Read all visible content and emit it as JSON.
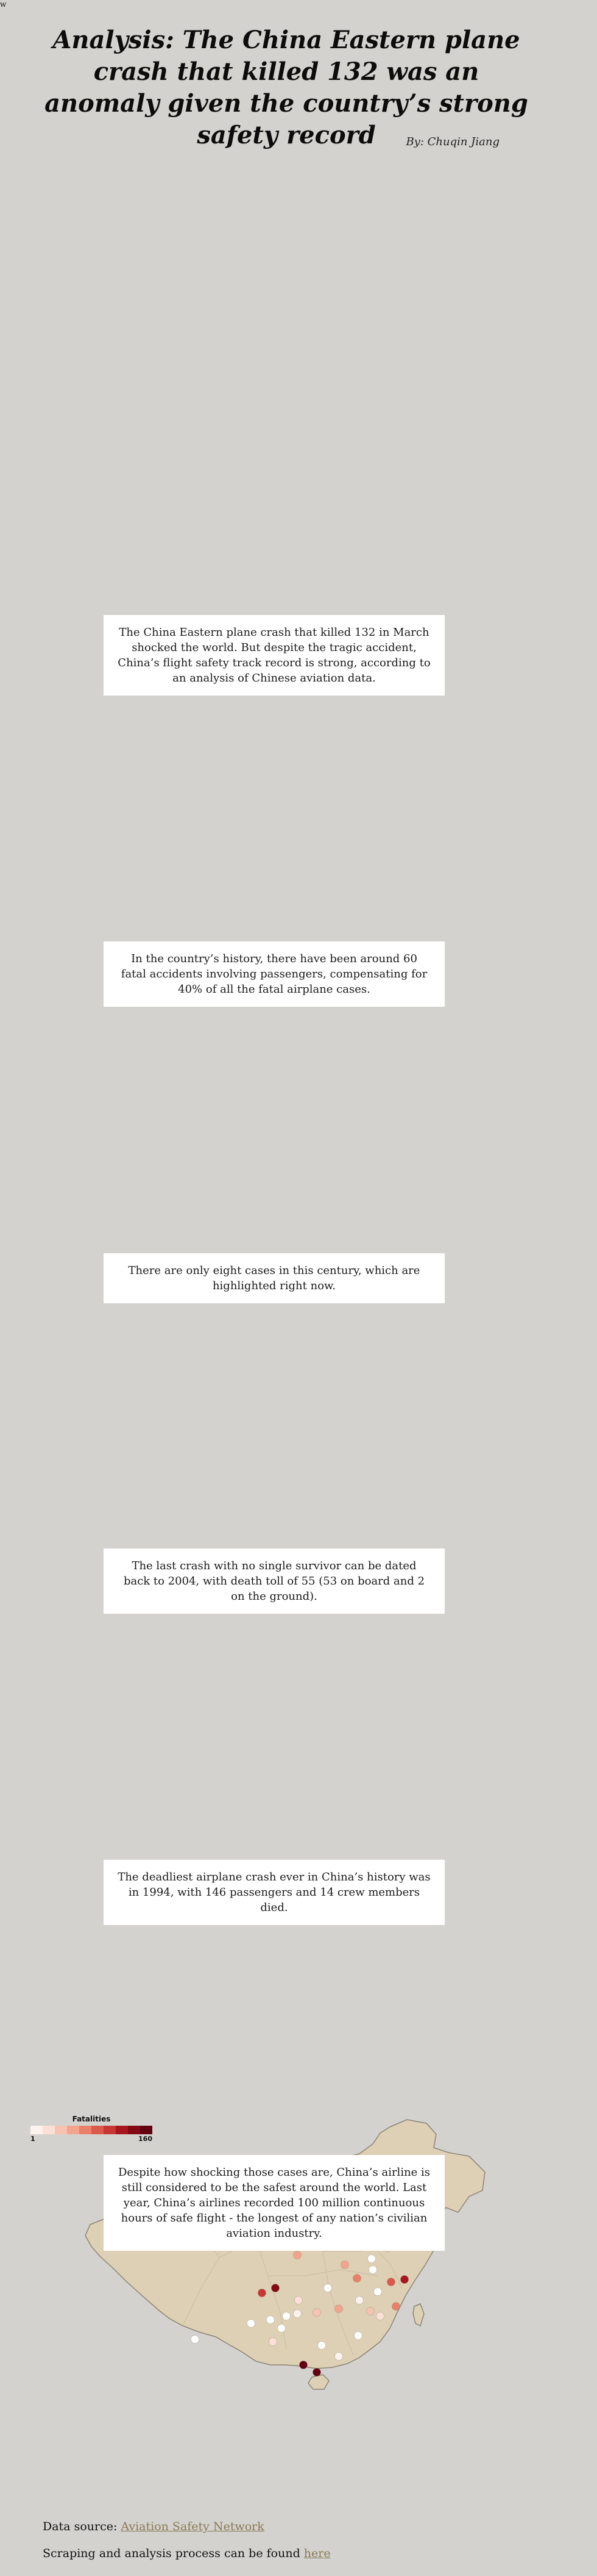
{
  "corner_mark": "w",
  "title": "Analysis: The China Eastern plane crash that killed 132 was an anomaly given the country’s strong safety record",
  "byline": "By: Chuqin Jiang",
  "cards": [
    "The China Eastern plane crash that killed 132 in March shocked the world. But despite the tragic accident, China’s flight safety track record is strong, according to an analysis of Chinese aviation data.",
    "In the country’s history, there have been around 60 fatal accidents involving passengers, compensating for 40% of all the fatal airplane cases.",
    "There are only eight cases in this century, which are highlighted right now.",
    "The last crash with no single survivor can be dated back to 2004, with death toll of 55 (53 on board and 2 on the ground).",
    "The deadliest airplane crash ever in China’s history was in 1994, with 146 passengers and 14 crew members died.",
    "Despite how shocking those cases are, China’s airline is still considered to be the safest around the world. Last year, China’s airlines recorded 100 million continuous hours of safe flight - the longest of any nation’s civilian aviation industry."
  ],
  "legend": {
    "title": "Fatalities",
    "min_label": "1",
    "max_label": "160",
    "colors": [
      "#fdf2ee",
      "#fbe0d6",
      "#f7c3b1",
      "#f2a48e",
      "#ea806c",
      "#dc5a4c",
      "#c73733",
      "#a8161f",
      "#830a14",
      "#650010"
    ]
  },
  "map": {
    "land_color": "#ddd0b4",
    "border_color": "#8c8576",
    "province_line_color": "#c9bc9f",
    "crash_sites": [
      {
        "fatalities": 1,
        "color": "#ffffff"
      },
      {
        "fatalities": 1,
        "color": "#ffffff"
      },
      {
        "fatalities": 2,
        "color": "#ffffff"
      },
      {
        "fatalities": 5,
        "color": "#fdf2ee"
      },
      {
        "fatalities": 8,
        "color": "#fbe0d6"
      },
      {
        "fatalities": 12,
        "color": "#f7c3b1"
      },
      {
        "fatalities": 20,
        "color": "#f2a48e"
      },
      {
        "fatalities": 35,
        "color": "#ea806c"
      },
      {
        "fatalities": 55,
        "color": "#dc5a4c"
      },
      {
        "fatalities": 80,
        "color": "#c73733"
      },
      {
        "fatalities": 108,
        "color": "#a8161f"
      },
      {
        "fatalities": 132,
        "color": "#830a14"
      },
      {
        "fatalities": 160,
        "color": "#650010"
      }
    ]
  },
  "footer": {
    "source_prefix": "Data source: ",
    "source_link": "Aviation Safety Network",
    "process_prefix": "Scraping and analysis process can be found ",
    "process_link": "here"
  }
}
